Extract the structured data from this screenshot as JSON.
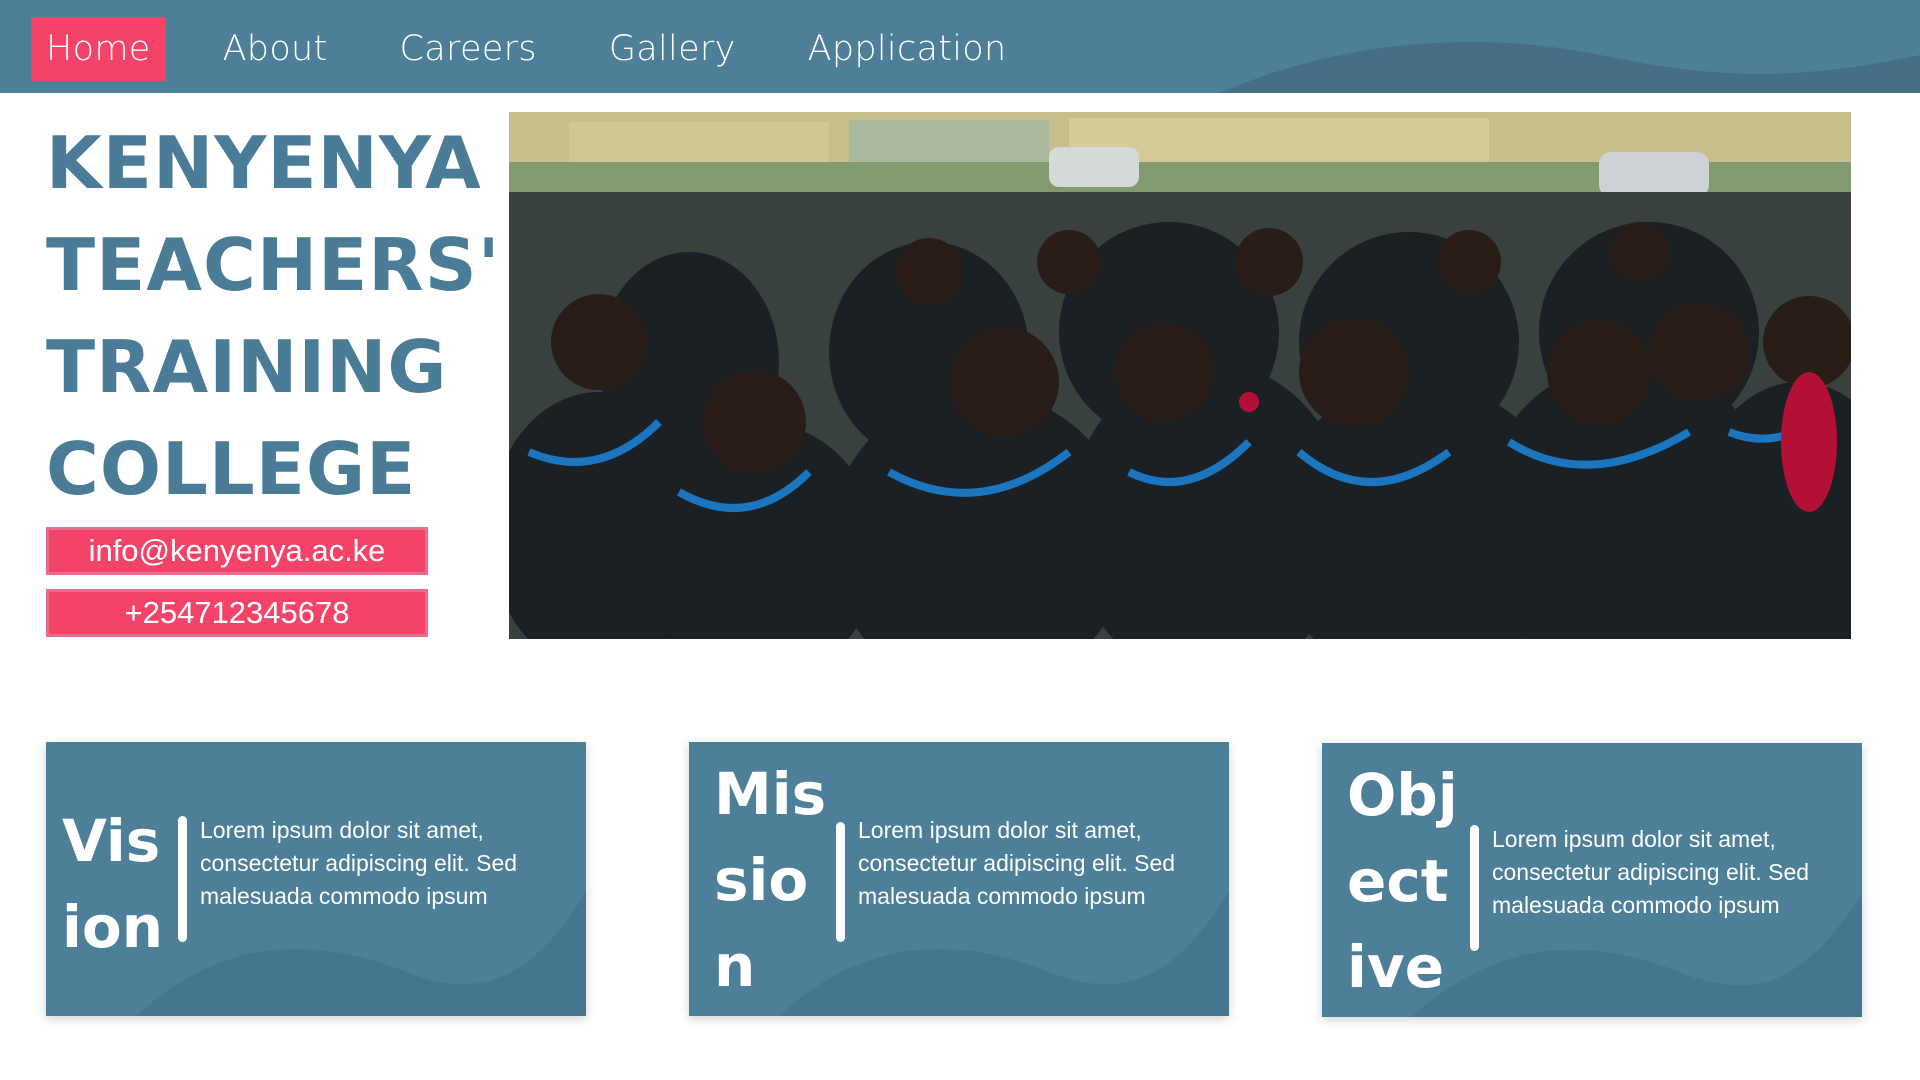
{
  "nav": {
    "items": [
      {
        "label": "Home",
        "active": true
      },
      {
        "label": "About",
        "active": false
      },
      {
        "label": "Careers",
        "active": false
      },
      {
        "label": "Gallery",
        "active": false
      },
      {
        "label": "Application",
        "active": false
      }
    ]
  },
  "hero": {
    "title_lines": [
      "KENYENYA",
      "TEACHERS'",
      "TRAINING",
      "COLLEGE"
    ],
    "email": "info@kenyenya.ac.ke",
    "phone": "+254712345678"
  },
  "cards": {
    "vision": {
      "title": "Vision",
      "text": "Lorem ipsum dolor sit amet, consectetur adipiscing elit. Sed malesuada commodo ipsum"
    },
    "mission": {
      "title": "Mission",
      "text": "Lorem ipsum dolor sit amet, consectetur adipiscing elit. Sed malesuada commodo ipsum"
    },
    "objective": {
      "title": "Objective",
      "text": "Lorem ipsum dolor sit amet, consectetur adipiscing elit. Sed malesuada commodo ipsum"
    }
  },
  "colors": {
    "primary": "#4d7f99",
    "accent": "#f44369",
    "title": "#4a7b97"
  }
}
